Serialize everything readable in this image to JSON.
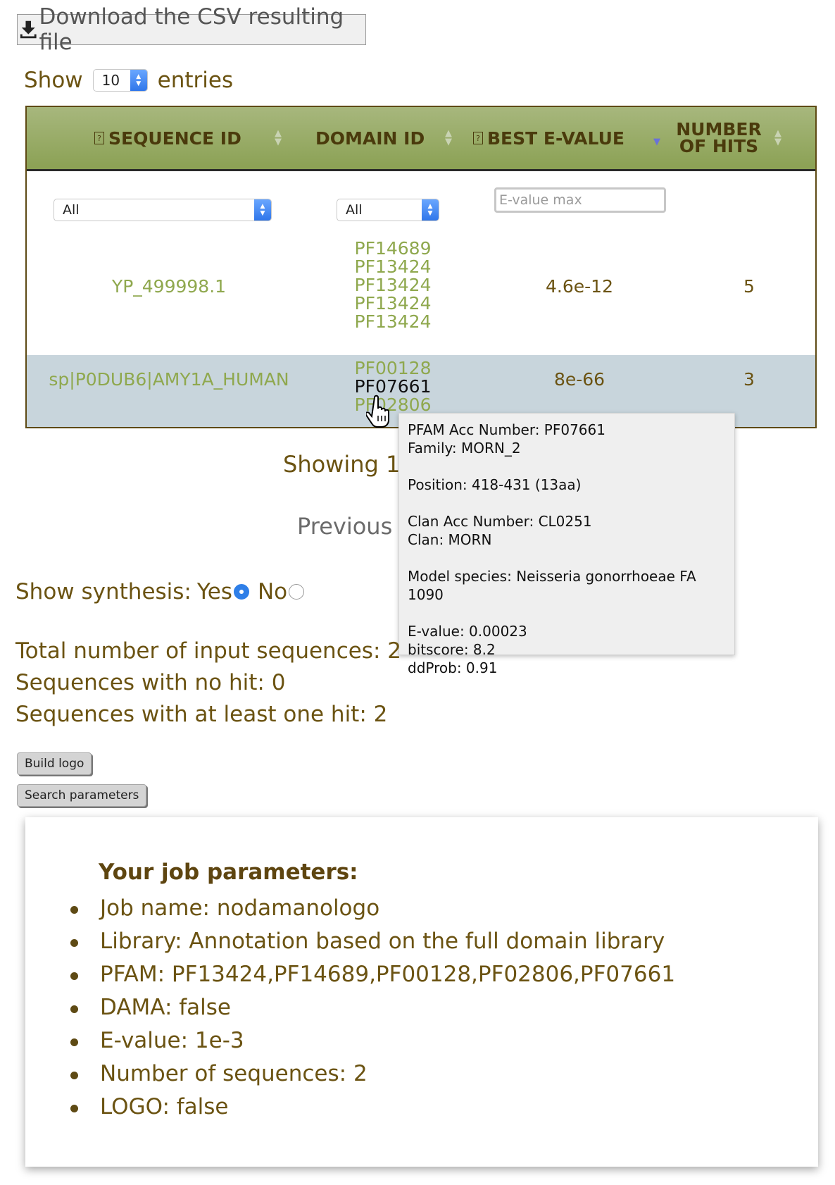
{
  "download_button": {
    "label": "Download the CSV resulting file",
    "icon": "download-icon"
  },
  "entries": {
    "show_label": "Show",
    "value": "10",
    "suffix": "entries"
  },
  "table": {
    "headers": {
      "sequence_id": "SEQUENCE ID",
      "domain_id": "DOMAIN ID",
      "best_evalue": "BEST E-VALUE",
      "number_of_hits_line1": "NUMBER",
      "number_of_hits_line2": "OF HITS"
    },
    "filters": {
      "sequence_id": "All",
      "domain_id": "All",
      "evalue_placeholder": "E-value max"
    },
    "rows": [
      {
        "sequence_id": "YP_499998.1",
        "domains": [
          "PF14689",
          "PF13424",
          "PF13424",
          "PF13424",
          "PF13424"
        ],
        "best_evalue": "4.6e-12",
        "hits": "5"
      },
      {
        "sequence_id": "sp|P0DUB6|AMY1A_HUMAN",
        "domains": [
          "PF00128",
          "PF07661",
          "PF02806"
        ],
        "best_evalue": "8e-66",
        "hits": "3"
      }
    ]
  },
  "tooltip": {
    "acc": "PFAM Acc Number: PF07661",
    "family": "Family: MORN_2",
    "position": "Position: 418-431 (13aa)",
    "clan_acc": "Clan Acc Number: CL0251",
    "clan": "Clan: MORN",
    "model_species": "Model species: Neisseria gonorrhoeae FA 1090",
    "evalue": "E-value: 0.00023",
    "bitscore": "bitscore: 8.2",
    "ddprob": "ddProb: 0.91"
  },
  "pagination": {
    "showing": "Showing 1",
    "previous": "Previous"
  },
  "synthesis": {
    "label": "Show synthesis:",
    "yes": "Yes",
    "no": "No",
    "selected": "Yes"
  },
  "stats": {
    "total": "Total number of input sequences: 2",
    "no_hit": "Sequences with no hit: 0",
    "at_least_one": "Sequences with at least one hit: 2"
  },
  "buttons": {
    "build_logo": "Build logo",
    "search_parameters": "Search parameters"
  },
  "params": {
    "title": "Your job parameters:",
    "items": [
      "Job name: nodamanologo",
      "Library: Annotation based on the full domain library",
      "PFAM: PF13424,PF14689,PF00128,PF02806,PF07661",
      "DAMA: false",
      "E-value: 1e-3",
      "Number of sequences: 2",
      "LOGO: false"
    ]
  },
  "colors": {
    "header_green": "#8ba154",
    "text_brown": "#6b5312",
    "link_green": "#8fa84e",
    "row_highlight": "#c8d5dc",
    "radio_blue": "#2f7fe8"
  }
}
